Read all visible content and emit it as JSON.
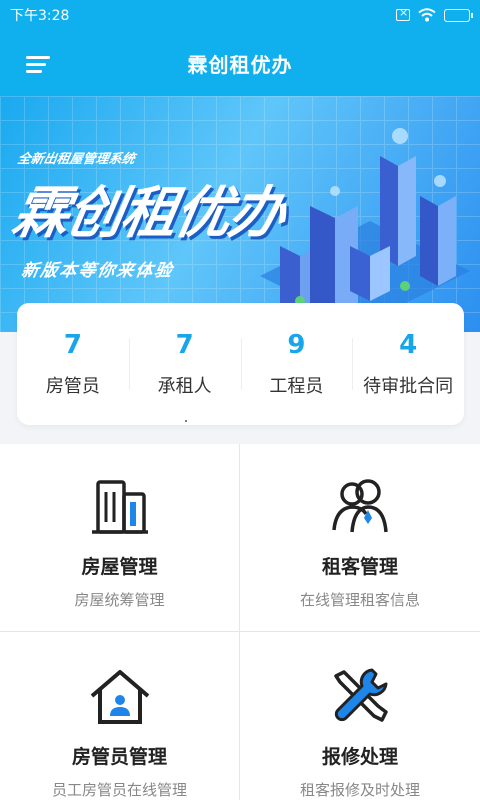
{
  "status_bar": {
    "time": "下午3:28"
  },
  "header": {
    "title": "霖创租优办"
  },
  "banner": {
    "subtitle": "全新出租屋管理系统",
    "headline": "霖创租优办",
    "slogan": "新版本等你来体验"
  },
  "stats": [
    {
      "value": "7",
      "label": "房管员"
    },
    {
      "value": "7",
      "label": "承租人"
    },
    {
      "value": "9",
      "label": "工程员"
    },
    {
      "value": "4",
      "label": "待审批合同"
    }
  ],
  "modules": [
    {
      "title": "房屋管理",
      "desc": "房屋统筹管理",
      "icon": "building-icon"
    },
    {
      "title": "租客管理",
      "desc": "在线管理租客信息",
      "icon": "tenants-icon"
    },
    {
      "title": "房管员管理",
      "desc": "员工房管员在线管理",
      "icon": "house-person-icon"
    },
    {
      "title": "报修处理",
      "desc": "租客报修及时处理",
      "icon": "wrench-icon"
    }
  ],
  "colors": {
    "primary": "#10b0ef",
    "accent": "#19a5ea",
    "icon_blue": "#1e86e8"
  }
}
